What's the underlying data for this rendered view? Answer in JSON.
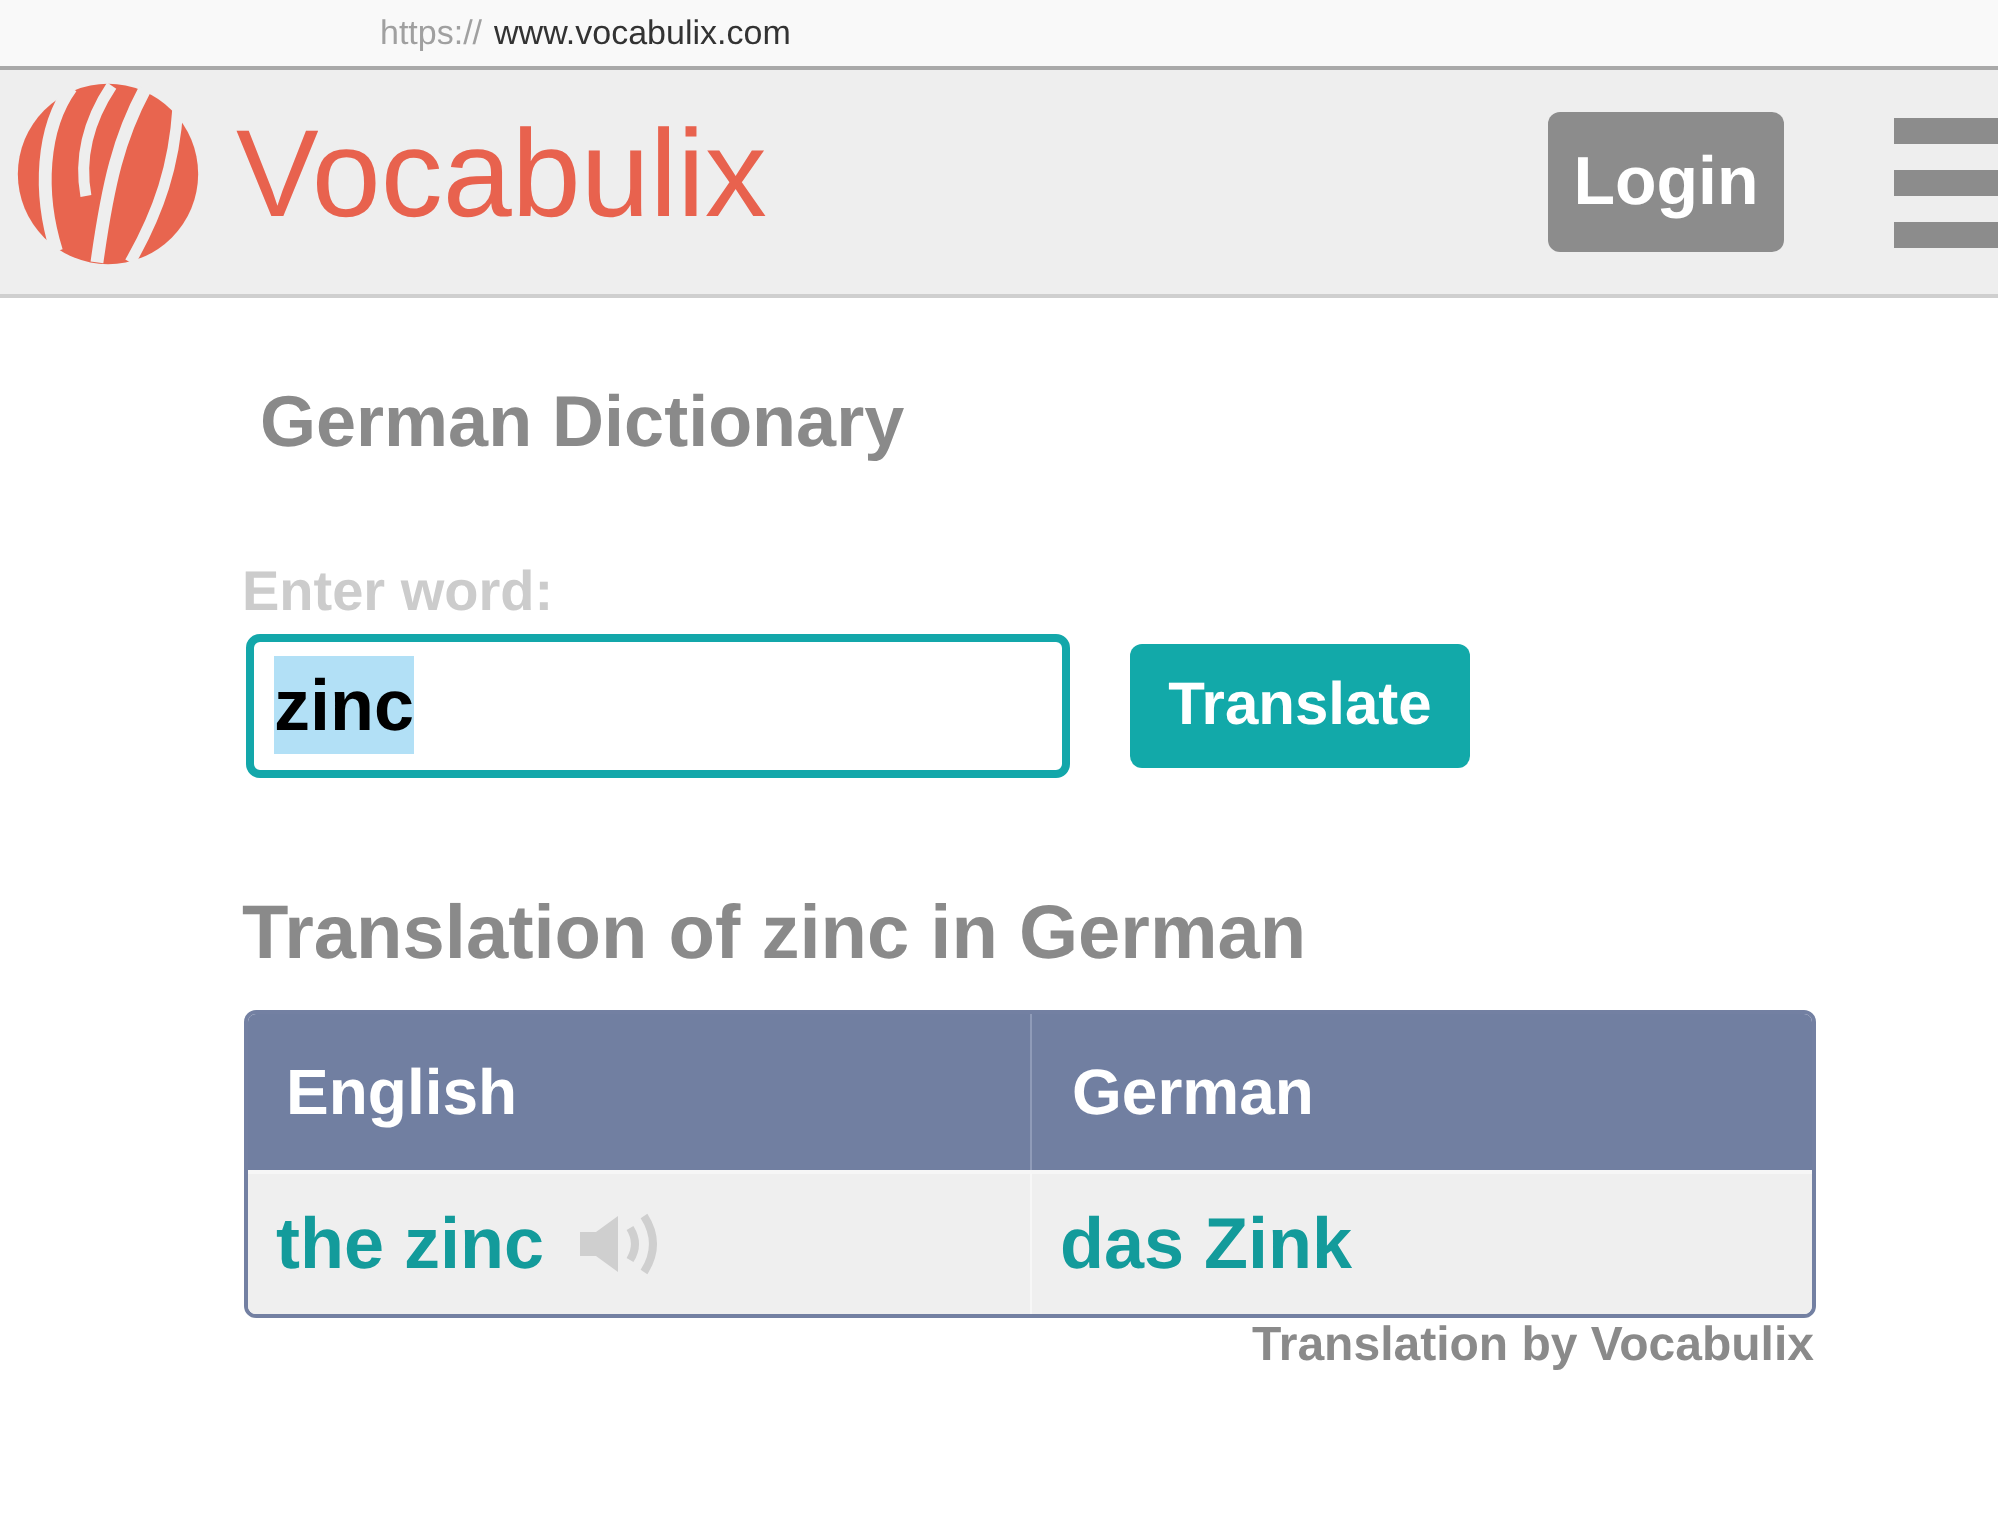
{
  "address_bar": {
    "scheme": "https://",
    "host": "www.vocabulix.com"
  },
  "header": {
    "logo_text": "Vocabulix",
    "login_button": "Login"
  },
  "search": {
    "title": "German Dictionary",
    "label": "Enter word:",
    "input": {
      "value": "zinc",
      "text_selected": true
    },
    "submit_button": "Translate"
  },
  "results": {
    "heading": "Translation of zinc in German",
    "table": {
      "columns": [
        "English",
        "German"
      ],
      "rows": [
        {
          "cells": [
            {
              "text": "the zinc",
              "audio": true
            },
            {
              "text": "das Zink",
              "audio": false
            }
          ]
        }
      ]
    },
    "credit": "Translation by Vocabulix"
  }
}
